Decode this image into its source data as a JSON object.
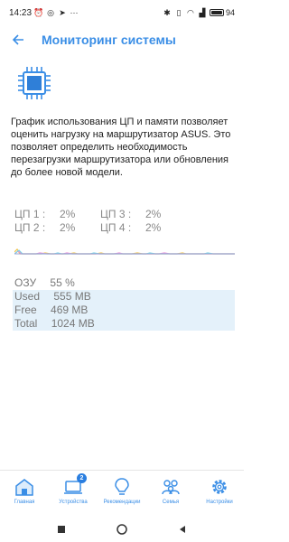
{
  "status_bar": {
    "time": "14:23",
    "battery": "94"
  },
  "header": {
    "title": "Мониторинг системы"
  },
  "description": "График использования ЦП и памяти позволяет оценить нагрузку на маршрутизатор ASUS. Это позволяет определить необходимость перезагрузки маршрутизатора или обновления до более новой модели.",
  "cpu": [
    {
      "label": "ЦП 1 :",
      "value": "2%"
    },
    {
      "label": "ЦП 3 :",
      "value": "2%"
    },
    {
      "label": "ЦП 2 :",
      "value": "2%"
    },
    {
      "label": "ЦП 4 :",
      "value": "2%"
    }
  ],
  "memory": {
    "ram_label": "ОЗУ",
    "ram_value": "55 %",
    "used_label": "Used",
    "used_value": "555 MB",
    "free_label": "Free",
    "free_value": "469 MB",
    "total_label": "Total",
    "total_value": "1024 MB"
  },
  "tabs": [
    {
      "label": "Главная",
      "icon": "home-icon"
    },
    {
      "label": "Устройства",
      "icon": "devices-icon",
      "badge": "2"
    },
    {
      "label": "Рекомендации",
      "icon": "lightbulb-icon"
    },
    {
      "label": "Семья",
      "icon": "family-icon"
    },
    {
      "label": "Настройки",
      "icon": "gear-icon"
    }
  ],
  "colors": {
    "accent": "#3a8ee6",
    "highlight": "#e4f1fa"
  }
}
